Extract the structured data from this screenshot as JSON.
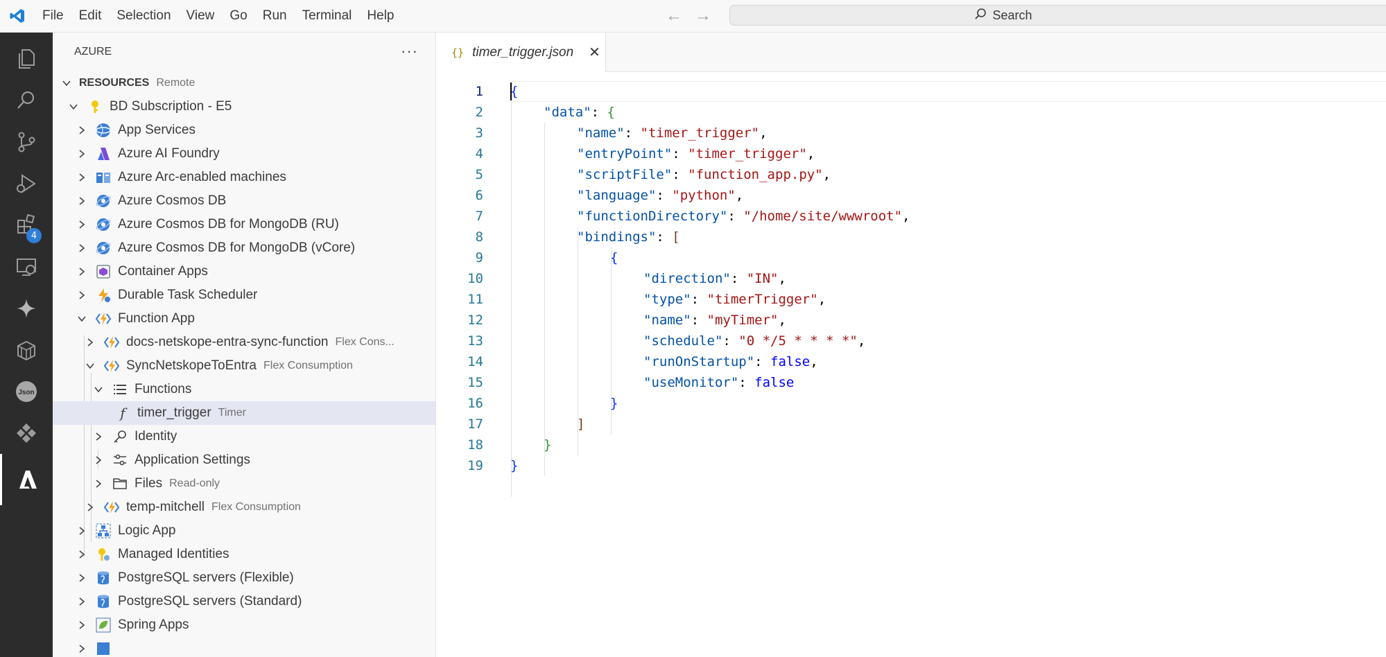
{
  "menu": [
    "File",
    "Edit",
    "Selection",
    "View",
    "Go",
    "Run",
    "Terminal",
    "Help"
  ],
  "search": {
    "label": "Search"
  },
  "activity": {
    "extensions_badge": "4",
    "json_label": "Json"
  },
  "sidebar": {
    "title": "AZURE",
    "section": {
      "label": "RESOURCES",
      "desc": "Remote"
    },
    "subscription": "BD Subscription - E5",
    "groups": [
      "App Services",
      "Azure AI Foundry",
      "Azure Arc-enabled machines",
      "Azure Cosmos DB",
      "Azure Cosmos DB for MongoDB (RU)",
      "Azure Cosmos DB for MongoDB (vCore)",
      "Container Apps",
      "Durable Task Scheduler",
      "Function App"
    ],
    "function_apps": [
      {
        "label": "docs-netskope-entra-sync-function",
        "desc": "Flex Cons..."
      },
      {
        "label": "SyncNetskopeToEntra",
        "desc": "Flex Consumption"
      }
    ],
    "functions_label": "Functions",
    "timer": {
      "label": "timer_trigger",
      "desc": "Timer"
    },
    "identity": "Identity",
    "app_settings": "Application Settings",
    "files": {
      "label": "Files",
      "desc": "Read-only"
    },
    "temp_app": {
      "label": "temp-mitchell",
      "desc": "Flex Consumption"
    },
    "more_groups": [
      "Logic App",
      "Managed Identities",
      "PostgreSQL servers (Flexible)",
      "PostgreSQL servers (Standard)",
      "Spring Apps"
    ]
  },
  "tab": {
    "label": "timer_trigger.json",
    "icon": "{}"
  },
  "editor": {
    "line_numbers": [
      "1",
      "2",
      "3",
      "4",
      "5",
      "6",
      "7",
      "8",
      "9",
      "10",
      "11",
      "12",
      "13",
      "14",
      "15",
      "16",
      "17",
      "18",
      "19"
    ],
    "code": {
      "l1": "{",
      "l2_key": "\"data\"",
      "l2_rest": ": ",
      "l2_br": "{",
      "l3_key": "\"name\"",
      "l3_val": "\"timer_trigger\"",
      "l4_key": "\"entryPoint\"",
      "l4_val": "\"timer_trigger\"",
      "l5_key": "\"scriptFile\"",
      "l5_val": "\"function_app.py\"",
      "l6_key": "\"language\"",
      "l6_val": "\"python\"",
      "l7_key": "\"functionDirectory\"",
      "l7_val": "\"/home/site/wwwroot\"",
      "l8_key": "\"bindings\"",
      "l8_br": "[",
      "l9": "{",
      "l10_key": "\"direction\"",
      "l10_val": "\"IN\"",
      "l11_key": "\"type\"",
      "l11_val": "\"timerTrigger\"",
      "l12_key": "\"name\"",
      "l12_val": "\"myTimer\"",
      "l13_key": "\"schedule\"",
      "l13_val": "\"0 */5 * * * *\"",
      "l14_key": "\"runOnStartup\"",
      "l14_val": "false",
      "l15_key": "\"useMonitor\"",
      "l15_val": "false",
      "l16": "}",
      "l17": "]",
      "l18": "}",
      "l19": "}"
    },
    "colon": ": ",
    "comma": ","
  },
  "colors": {
    "activity_bg": "#2c2c2c",
    "sidebar_bg": "#f8f8f8",
    "selection": "#e4e6f1",
    "string": "#a31515",
    "key": "#0451a5",
    "keyword": "#0000ff"
  }
}
